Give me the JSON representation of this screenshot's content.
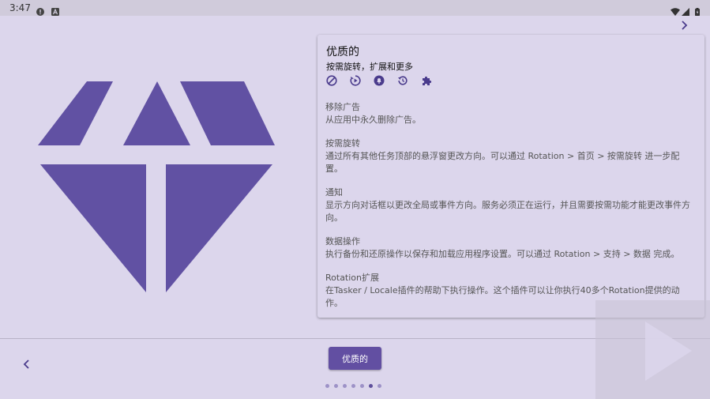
{
  "status_bar": {
    "time": "3:47",
    "left_icons": [
      "alert-circle-icon",
      "a-badge-icon"
    ],
    "right_icons": [
      "wifi-icon",
      "signal-icon",
      "battery-icon"
    ]
  },
  "colors": {
    "accent": "#624fa2",
    "background": "#dcd6ec",
    "gem": "#6151a3"
  },
  "hero": {
    "icon": "diamond-icon"
  },
  "card": {
    "title": "优质的",
    "subtitle": "按需旋转，扩展和更多",
    "feature_icons": [
      "block-icon",
      "rotate-play-icon",
      "notification-icon",
      "restore-icon",
      "extension-icon"
    ],
    "features": [
      {
        "title": "移除广告",
        "description": "从应用中永久删除广告。"
      },
      {
        "title": "按需旋转",
        "description": "通过所有其他任务顶部的悬浮窗更改方向。可以通过 Rotation > 首页 > 按需旋转 进一步配置。"
      },
      {
        "title": "通知",
        "description": "显示方向对话框以更改全局或事件方向。服务必须正在运行，并且需要按需功能才能更改事件方向。"
      },
      {
        "title": "数据操作",
        "description": "执行备份和还原操作以保存和加载应用程序设置。可以通过 Rotation > 支持 > 数据 完成。"
      },
      {
        "title": "Rotation扩展",
        "description": "在Tasker / Locale插件的帮助下执行操作。这个插件可以让你执行40多个Rotation提供的动作。"
      }
    ]
  },
  "bottom": {
    "button_label": "优质的",
    "prev_icon": "chevron-left-icon",
    "next_icon": "chevron-right-icon",
    "dots_total": 7,
    "dots_active_index": 5
  }
}
